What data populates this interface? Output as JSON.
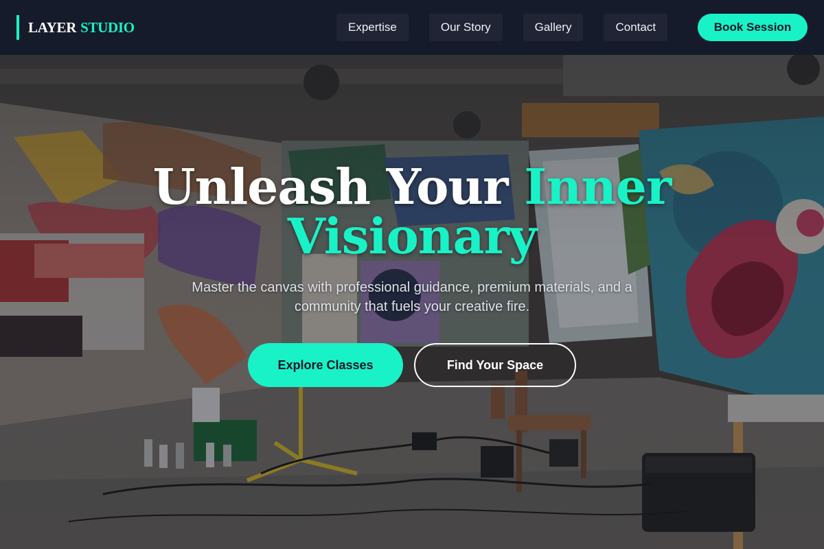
{
  "brand": {
    "word1": "LAYER",
    "word2": "STUDIO"
  },
  "nav": {
    "links": [
      {
        "label": "Expertise"
      },
      {
        "label": "Our Story"
      },
      {
        "label": "Gallery"
      },
      {
        "label": "Contact"
      }
    ],
    "cta_label": "Book Session"
  },
  "hero": {
    "headline_part1": "Unleash Your",
    "headline_accent_1": "Inner",
    "headline_accent_2": "Visionary",
    "subtitle": "Master the canvas with professional guidance, premium materials, and a community that fuels your creative fire.",
    "primary_button": "Explore Classes",
    "secondary_button": "Find Your Space"
  },
  "colors": {
    "accent": "#19f2c6",
    "nav_background": "#161b2c",
    "text_dark": "#11162a"
  }
}
